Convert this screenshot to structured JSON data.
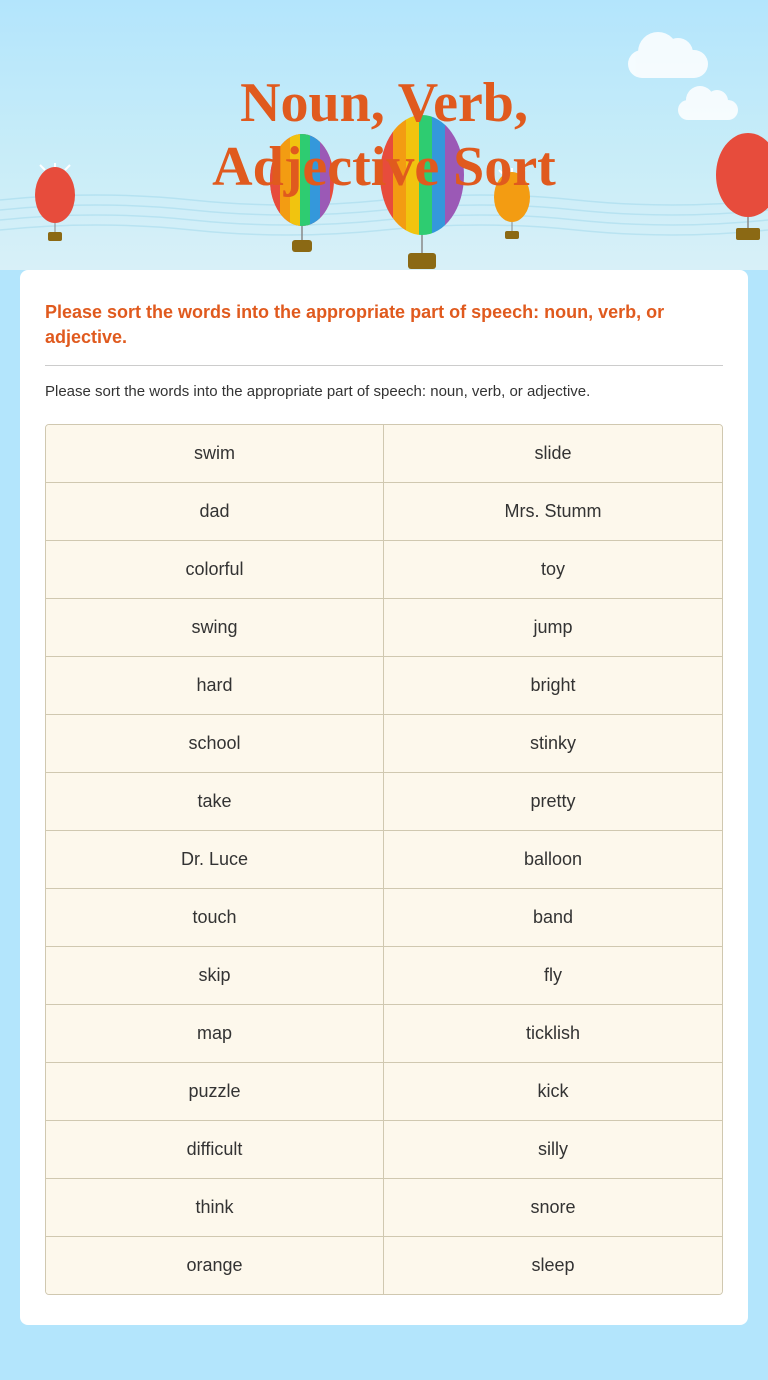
{
  "header": {
    "title_line1": "Noun, Verb,",
    "title_line2": "Adjective Sort"
  },
  "instructions": {
    "title": "Please sort the words into the appropriate part of speech: noun, verb, or adjective.",
    "body": "Please sort the words into the appropriate part of speech: noun, verb, or adjective."
  },
  "words": [
    {
      "left": "swim",
      "right": "slide"
    },
    {
      "left": "dad",
      "right": "Mrs. Stumm"
    },
    {
      "left": "colorful",
      "right": "toy"
    },
    {
      "left": "swing",
      "right": "jump"
    },
    {
      "left": "hard",
      "right": "bright"
    },
    {
      "left": "school",
      "right": "stinky"
    },
    {
      "left": "take",
      "right": "pretty"
    },
    {
      "left": "Dr. Luce",
      "right": "balloon"
    },
    {
      "left": "touch",
      "right": "band"
    },
    {
      "left": "skip",
      "right": "fly"
    },
    {
      "left": "map",
      "right": "ticklish"
    },
    {
      "left": "puzzle",
      "right": "kick"
    },
    {
      "left": "difficult",
      "right": "silly"
    },
    {
      "left": "think",
      "right": "snore"
    },
    {
      "left": "orange",
      "right": "sleep"
    }
  ],
  "balloons": {
    "colors": {
      "rainbow": [
        "#e74c3c",
        "#f39c12",
        "#f1c40f",
        "#2ecc71",
        "#3498db",
        "#9b59b6"
      ]
    }
  }
}
